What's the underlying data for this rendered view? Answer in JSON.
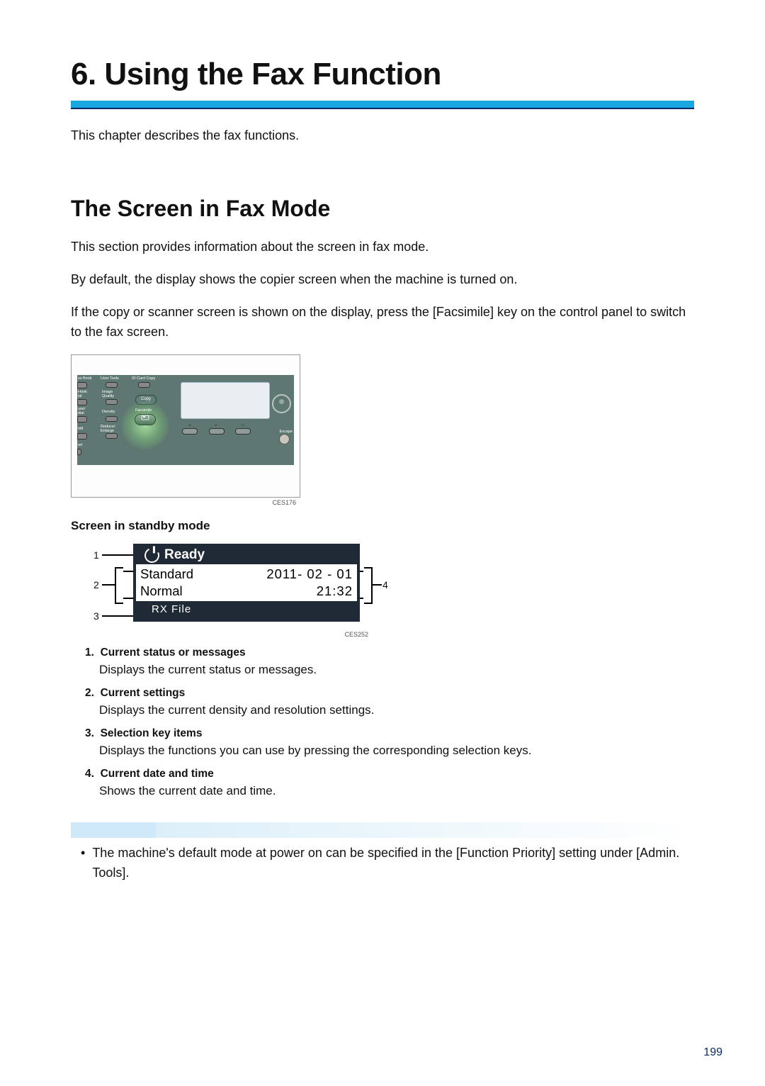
{
  "chapter_title": "6. Using the Fax Function",
  "intro": "This chapter describes the fax functions.",
  "section_title": "The Screen in Fax Mode",
  "para1": "This section provides information about the screen in fax mode.",
  "para2": "By default, the display shows the copier screen when the machine is turned on.",
  "para3": "If the copy or scanner screen is shown on the display, press the [Facsimile] key on the control panel to switch to the fax screen.",
  "fig1": {
    "caption": "CES176",
    "labels": {
      "addr": "ss Book",
      "user_tools": "User Tools",
      "id_copy": "ID Card Copy",
      "hook": "Hook\nial",
      "image_q": "Image\nQuality",
      "pause": "use/\ndial",
      "density": "Density",
      "shift": "hift",
      "reduce": "Reduce/\nEnlarge",
      "copy": "Copy",
      "fax": "Facsimile",
      "escape": "Escape",
      "ert": "ert"
    }
  },
  "standby_heading": "Screen in standby mode",
  "standby": {
    "status": "Ready",
    "resolution": "Standard",
    "density": "Normal",
    "date": "2011- 02 - 01",
    "time": "21:32",
    "rx": "RX File",
    "caption": "CES252",
    "callouts": {
      "c1": "1",
      "c2": "2",
      "c3": "3",
      "c4": "4"
    }
  },
  "defs": [
    {
      "n": "1.",
      "t": "Current status or messages",
      "b": "Displays the current status or messages."
    },
    {
      "n": "2.",
      "t": "Current settings",
      "b": "Displays the current density and resolution settings."
    },
    {
      "n": "3.",
      "t": "Selection key items",
      "b": "Displays the functions you can use by pressing the corresponding selection keys."
    },
    {
      "n": "4.",
      "t": "Current date and time",
      "b": "Shows the current date and time."
    }
  ],
  "note_bullet": "The machine's default mode at power on can be specified in the [Function Priority] setting under [Admin. Tools].",
  "page_number": "199"
}
